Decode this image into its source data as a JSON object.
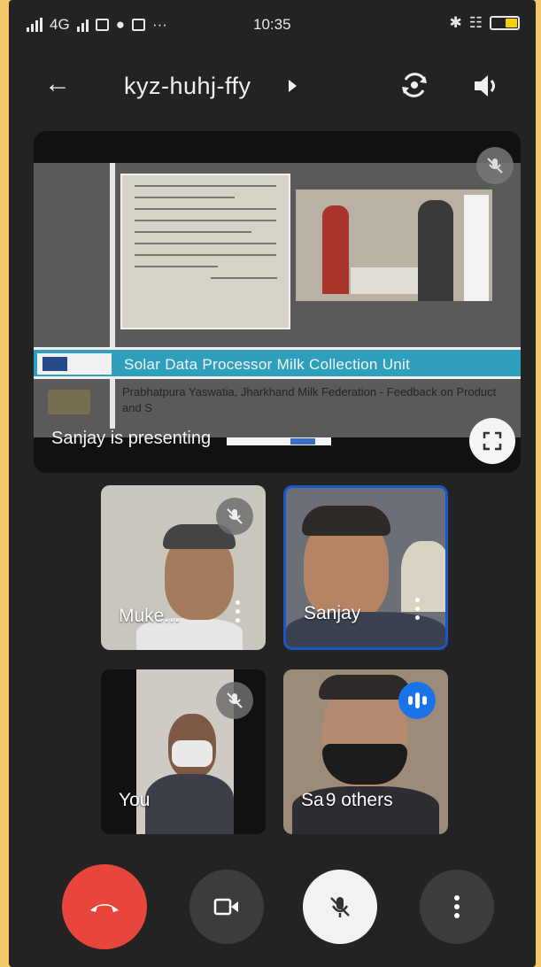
{
  "status_bar": {
    "network": "4G",
    "time": "10:35",
    "overflow": "···"
  },
  "header": {
    "meeting_code": "kyz-huhj-ffy",
    "icons": [
      "back-arrow-icon",
      "switch-camera-icon",
      "speaker-icon"
    ]
  },
  "presentation": {
    "slide_title": "Solar Data Processor Milk Collection Unit",
    "slide_subtitle": "Prabhatpura Yaswatia, Jharkhand Milk Federation - Feedback on Product and S",
    "presenting_label": "Sanjay is presenting",
    "mic_muted": true
  },
  "participants": [
    {
      "name": "Muke...",
      "mic_muted": true
    },
    {
      "name": "Sanjay",
      "mic_muted": false,
      "active_speaker": true
    },
    {
      "name": "You",
      "mic_muted": true
    },
    {
      "name": "Sa",
      "overlay_label": "9 others",
      "speaking": true
    }
  ],
  "controls": [
    "end-call",
    "video-toggle",
    "mic-toggle",
    "more-options"
  ],
  "colors": {
    "background": "#232323",
    "end_call": "#e8453c",
    "active_border": "#1a56c7",
    "speaking_badge": "#1a73e8",
    "banner": "#2e9fbc"
  }
}
